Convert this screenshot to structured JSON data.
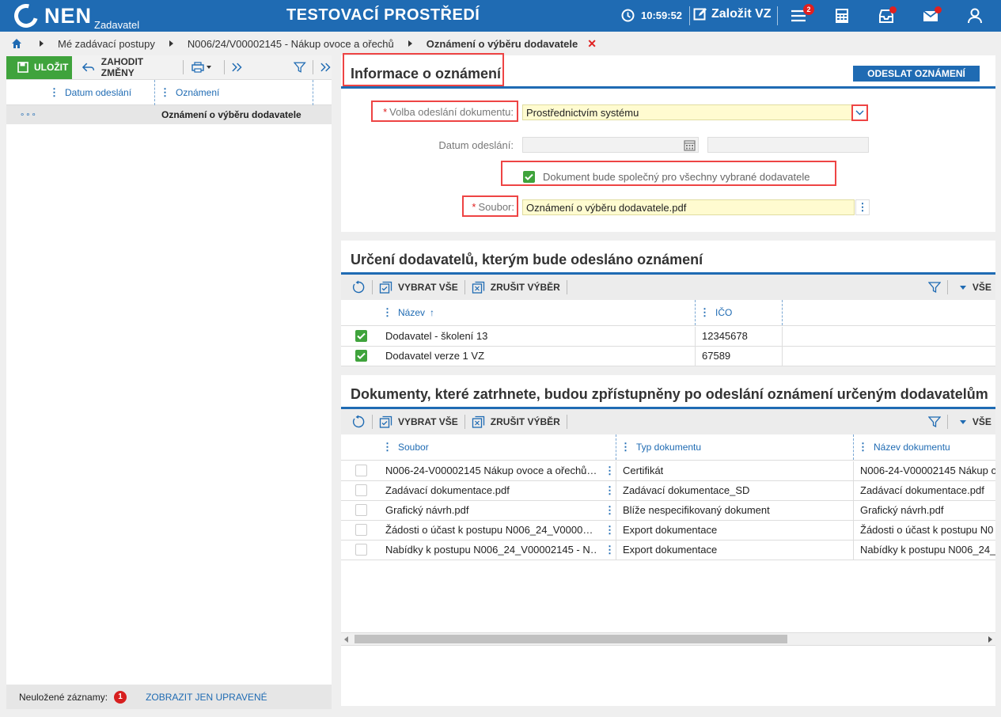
{
  "header": {
    "logo": "NEN",
    "logo_sub": "Zadavatel",
    "env_title": "TESTOVACÍ PROSTŘEDÍ",
    "clock": "10:59:52",
    "new_vz": "Založit VZ",
    "menu_badge": "2"
  },
  "breadcrumb": {
    "items": [
      "Mé zadávací postupy",
      "N006/24/V00002145 - Nákup ovoce a ořechů",
      "Oznámení o výběru dodavatele"
    ]
  },
  "left_panel": {
    "save_label": "ULOŽIT",
    "discard_label": "ZAHODIT ZMĚNY",
    "col_date": "Datum odeslání",
    "col_notice": "Oznámení",
    "row_dots": "∘∘∘",
    "row_text": "Oznámení o výběru dodavatele",
    "unsaved_label": "Neuložené záznamy:",
    "unsaved_count": "1",
    "show_modified": "ZOBRAZIT JEN UPRAVENÉ"
  },
  "info": {
    "title": "Informace o oznámení",
    "send_button": "ODESLAT OZNÁMENÍ",
    "send_method_label": "Volba odeslání dokumentu:",
    "send_method_value": "Prostřednictvím systému",
    "date_label": "Datum odeslání:",
    "common_doc_label": "Dokument bude společný pro všechny vybrané dodavatele",
    "file_label": "Soubor:",
    "file_value": "Oznámení o výběru dodavatele.pdf"
  },
  "suppliers": {
    "title": "Určení dodavatelů, kterým bude odesláno oznámení",
    "select_all": "VYBRAT VŠE",
    "deselect": "ZRUŠIT VÝBĚR",
    "all_label": "VŠE",
    "col_name": "Název",
    "col_ico": "IČO",
    "rows": [
      {
        "name": "Dodavatel - školení 13",
        "ico": "12345678"
      },
      {
        "name": "Dodavatel verze 1 VZ",
        "ico": "67589"
      }
    ]
  },
  "documents": {
    "title": "Dokumenty, které zatrhnete, budou zpřístupněny po odeslání oznámení určeným dodavatelům",
    "select_all": "VYBRAT VŠE",
    "deselect": "ZRUŠIT VÝBĚR",
    "all_label": "VŠE",
    "col_file": "Soubor",
    "col_type": "Typ dokumentu",
    "col_name": "Název dokumentu",
    "rows": [
      {
        "file": "N006-24-V00002145 Nákup ovoce a ořechů…",
        "type": "Certifikát",
        "name": "N006-24-V00002145 Nákup o"
      },
      {
        "file": "Zadávací dokumentace.pdf",
        "type": "Zadávací dokumentace_SD",
        "name": "Zadávací dokumentace.pdf"
      },
      {
        "file": "Grafický návrh.pdf",
        "type": "Blíže nespecifikovaný dokument",
        "name": "Grafický návrh.pdf"
      },
      {
        "file": "Žádosti o účast k postupu N006_24_V0000…",
        "type": "Export dokumentace",
        "name": "Žádosti o účast k postupu N0"
      },
      {
        "file": "Nabídky k postupu N006_24_V00002145 - N…",
        "type": "Export dokumentace",
        "name": "Nabídky k postupu N006_24_V"
      }
    ]
  }
}
